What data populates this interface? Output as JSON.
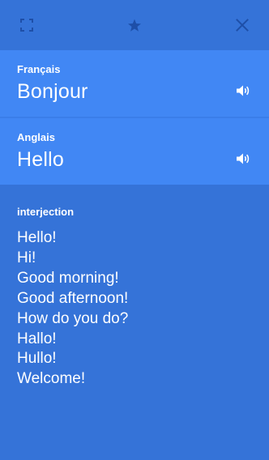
{
  "toolbar": {
    "icons": {
      "expand": "expand-icon",
      "favorite": "star-icon",
      "close": "close-icon"
    },
    "colors": {
      "icon": "#1e4fa8"
    }
  },
  "source": {
    "language": "Français",
    "text": "Bonjour",
    "speaker_icon": "speaker-icon"
  },
  "target": {
    "language": "Anglais",
    "text": "Hello",
    "speaker_icon": "speaker-icon"
  },
  "dictionary": {
    "part_of_speech": "interjection",
    "translations": [
      "Hello!",
      "Hi!",
      "Good morning!",
      "Good afternoon!",
      "How do you do?",
      "Hallo!",
      "Hullo!",
      "Welcome!"
    ]
  },
  "colors": {
    "background": "#3573d8",
    "card": "#4187f4",
    "text": "#ffffff"
  }
}
